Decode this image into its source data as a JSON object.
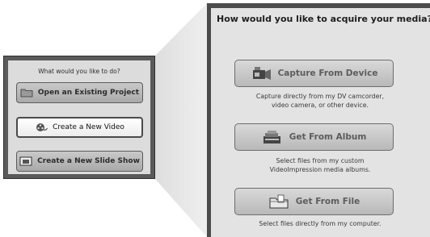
{
  "small_menu": {
    "title": "What would you like to do?",
    "buttons": [
      {
        "label": "Open an Existing Project",
        "icon": "folder-icon"
      },
      {
        "label": "Create a New Video",
        "icon": "film-reel-icon",
        "selected": true
      },
      {
        "label": "Create a New Slide Show",
        "icon": "slide-show-icon"
      }
    ]
  },
  "acquire_menu": {
    "title": "How would you like to acquire your media?",
    "options": [
      {
        "label": "Capture From Device",
        "icon": "camcorder-icon",
        "description_lines": [
          "Capture directly from my DV camcorder,",
          "video camera, or other device."
        ]
      },
      {
        "label": "Get From Album",
        "icon": "album-icon",
        "description_lines": [
          "Select files from my custom",
          "VideoImpression media albums."
        ]
      },
      {
        "label": "Get From File",
        "icon": "folder-file-icon",
        "description_lines": [
          "Select files directly from my computer."
        ]
      }
    ]
  },
  "colors": {
    "panel_border": "#4c4c4c",
    "panel_background": "#e3e3e3",
    "button_text": "#5c5c5c"
  }
}
